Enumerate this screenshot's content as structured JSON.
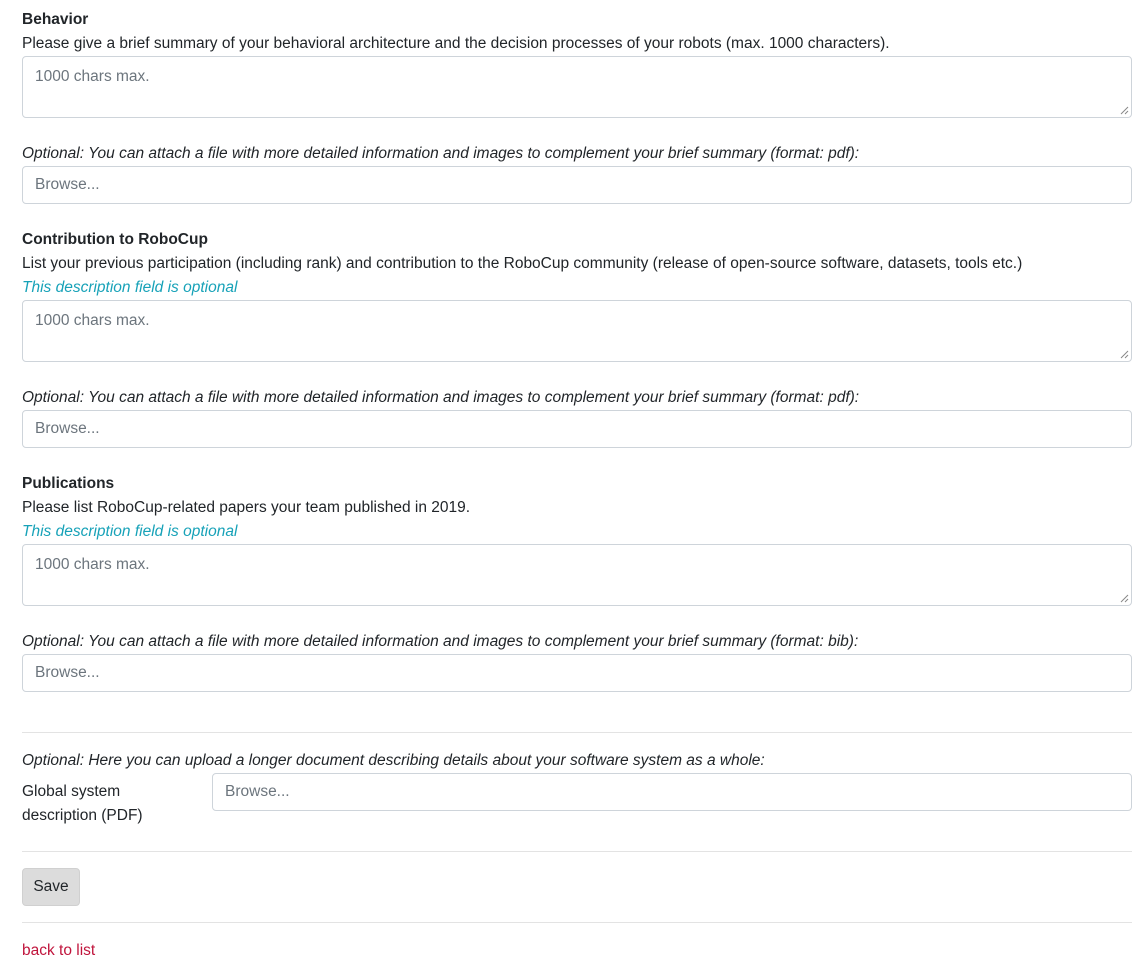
{
  "behavior": {
    "heading": "Behavior",
    "description": "Please give a brief summary of your behavioral architecture and the decision processes of your robots (max. 1000 characters).",
    "textarea_placeholder": "1000 chars max.",
    "attach_hint": "Optional: You can attach a file with more detailed information and images to complement your brief summary (format: pdf):",
    "file_placeholder": "Browse..."
  },
  "contribution": {
    "heading": "Contribution to RoboCup",
    "description": "List your previous participation (including rank) and contribution to the RoboCup community (release of open-source software, datasets, tools etc.)",
    "optional_note": "This description field is optional",
    "textarea_placeholder": "1000 chars max.",
    "attach_hint": "Optional: You can attach a file with more detailed information and images to complement your brief summary (format: pdf):",
    "file_placeholder": "Browse..."
  },
  "publications": {
    "heading": "Publications",
    "description": "Please list RoboCup-related papers your team published in 2019.",
    "optional_note": "This description field is optional",
    "textarea_placeholder": "1000 chars max.",
    "attach_hint": "Optional: You can attach a file with more detailed information and images to complement your brief summary (format: bib):",
    "file_placeholder": "Browse..."
  },
  "global": {
    "hint": "Optional: Here you can upload a longer document describing details about your software system as a whole:",
    "label_line1": "Global system",
    "label_line2": "description (PDF)",
    "file_placeholder": "Browse..."
  },
  "actions": {
    "save_label": "Save",
    "back_link": "back to list"
  },
  "colors": {
    "optional_text": "#17a2b8",
    "link": "#c0143c",
    "button_bg": "#dcdcdc",
    "border": "#ced4da"
  }
}
